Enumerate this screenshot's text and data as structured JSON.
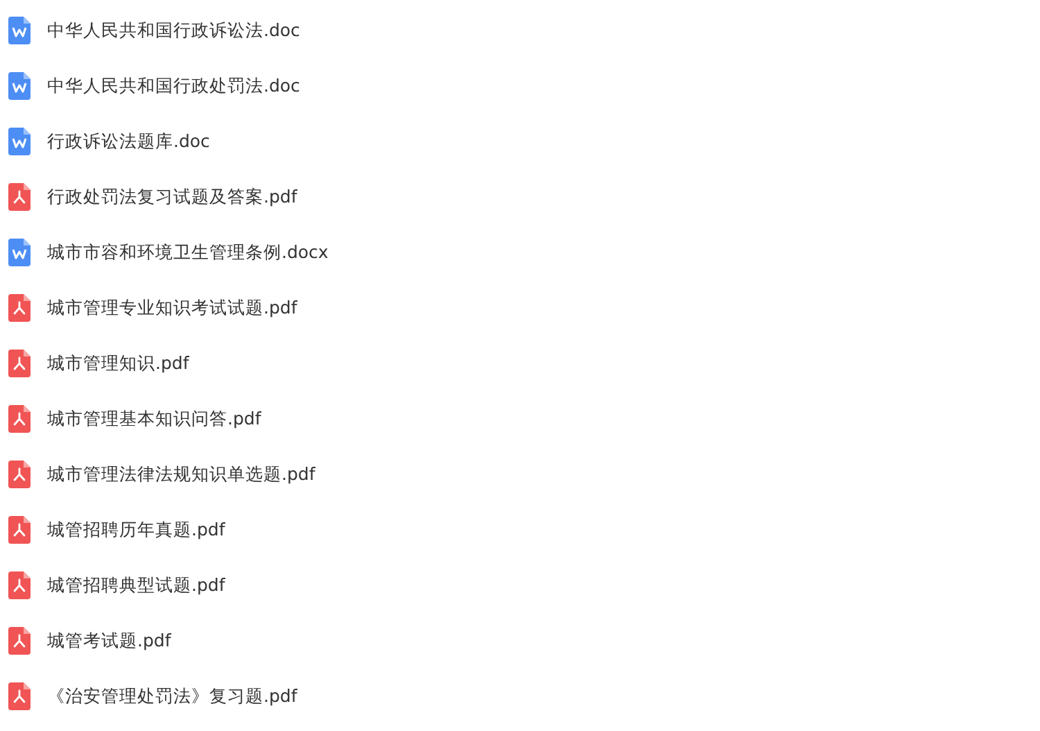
{
  "files": [
    {
      "name": "中华人民共和国行政诉讼法.doc",
      "kind": "word"
    },
    {
      "name": "中华人民共和国行政处罚法.doc",
      "kind": "word"
    },
    {
      "name": "行政诉讼法题库.doc",
      "kind": "word"
    },
    {
      "name": "行政处罚法复习试题及答案.pdf",
      "kind": "pdf"
    },
    {
      "name": "城市市容和环境卫生管理条例.docx",
      "kind": "word"
    },
    {
      "name": "城市管理专业知识考试试题.pdf",
      "kind": "pdf"
    },
    {
      "name": "城市管理知识.pdf",
      "kind": "pdf"
    },
    {
      "name": "城市管理基本知识问答.pdf",
      "kind": "pdf"
    },
    {
      "name": "城市管理法律法规知识单选题.pdf",
      "kind": "pdf"
    },
    {
      "name": "城管招聘历年真题.pdf",
      "kind": "pdf"
    },
    {
      "name": "城管招聘典型试题.pdf",
      "kind": "pdf"
    },
    {
      "name": "城管考试题.pdf",
      "kind": "pdf"
    },
    {
      "name": "《治安管理处罚法》复习题.pdf",
      "kind": "pdf"
    }
  ]
}
